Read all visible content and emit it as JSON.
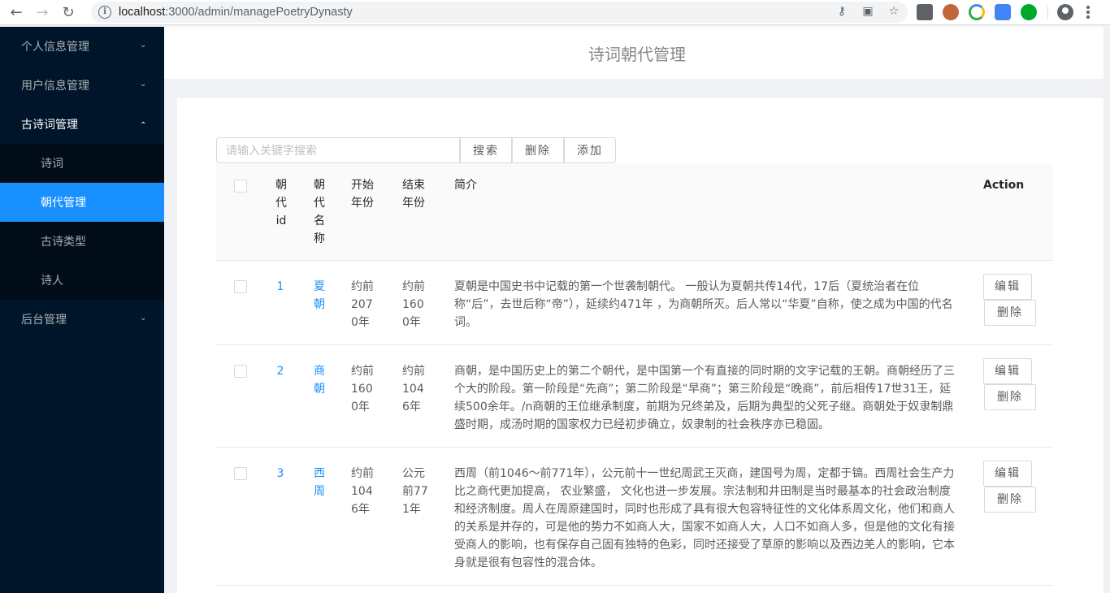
{
  "browser": {
    "url_host": "localhost",
    "url_path": ":3000/admin/managePoetryDynasty"
  },
  "sidebar": {
    "groups": [
      {
        "label": "个人信息管理"
      },
      {
        "label": "用户信息管理"
      },
      {
        "label": "古诗词管理",
        "items": [
          "诗词",
          "朝代管理",
          "古诗类型",
          "诗人"
        ]
      },
      {
        "label": "后台管理"
      }
    ]
  },
  "header": {
    "title": "诗词朝代管理"
  },
  "toolbar": {
    "search_placeholder": "请输入关键字搜索",
    "search_label": "搜索",
    "delete_label": "删除",
    "add_label": "添加"
  },
  "table": {
    "columns": [
      "朝代id",
      "朝代名称",
      "开始年份",
      "结束年份",
      "简介",
      "Action"
    ],
    "rows": [
      {
        "id": "1",
        "name": "夏朝",
        "start": "约前2070年",
        "end": "约前1600年",
        "intro": "夏朝是中国史书中记载的第一个世袭制朝代。 一般认为夏朝共传14代，17后（夏统治者在位称“后”，去世后称“帝”），延续约471年 ，为商朝所灭。后人常以“华夏”自称，使之成为中国的代名词。"
      },
      {
        "id": "2",
        "name": "商朝",
        "start": "约前1600年",
        "end": "约前1046年",
        "intro": "商朝，是中国历史上的第二个朝代，是中国第一个有直接的同时期的文字记载的王朝。商朝经历了三个大的阶段。第一阶段是“先商”；第二阶段是“早商”；第三阶段是“晚商”，前后相传17世31王，延续500余年。/n商朝的王位继承制度，前期为兄终弟及，后期为典型的父死子继。商朝处于奴隶制鼎盛时期，成汤时期的国家权力已经初步确立，奴隶制的社会秩序亦已稳固。"
      },
      {
        "id": "3",
        "name": "西周",
        "start": "约前1046年",
        "end": "公元前771年",
        "intro": "西周（前1046～前771年），公元前十一世纪周武王灭商，建国号为周，定都于镐。西周社会生产力比之商代更加提高， 农业繁盛， 文化也进一步发展。宗法制和井田制是当时最基本的社会政治制度和经济制度。周人在周原建国时，同时也形成了具有很大包容特征性的文化体系周文化，他们和商人的关系是并存的，可是他的势力不如商人大，国家不如商人大，人口不如商人多，但是他的文化有接受商人的影响，也有保存自己固有独特的色彩，同时还接受了草原的影响以及西边羌人的影响，它本身就是很有包容性的混合体。"
      }
    ],
    "edit_label": "编辑",
    "delete_label": "删除"
  }
}
